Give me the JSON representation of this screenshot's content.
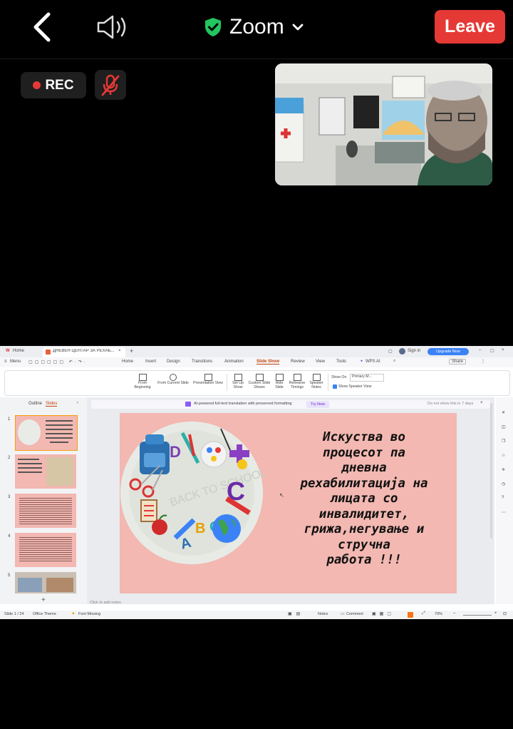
{
  "topbar": {
    "meeting_name": "Zoom",
    "leave_label": "Leave",
    "rec_label": "REC",
    "icons": [
      "back-chevron-icon",
      "speaker-icon",
      "shield-check-icon",
      "chevron-down-icon",
      "mic-muted-icon"
    ],
    "colors": {
      "leave": "#e53935",
      "shield": "#22c55e",
      "background": "#000000"
    }
  },
  "app": {
    "tabs": [
      "Home",
      "ДНЕВЕН ЦЕНТАР ЗА РЕХАБ..."
    ],
    "menu_label": "Menu",
    "ribbon_tabs": [
      "Home",
      "Insert",
      "Design",
      "Transitions",
      "Animation",
      "Slide Show",
      "Review",
      "View",
      "Tools",
      "WPS AI"
    ],
    "active_tab": "Slide Show",
    "sign_in": "Sign in",
    "upgrade": "Upgrade Now",
    "share": "Share",
    "ribbon_buttons": [
      "From Beginning",
      "From Current Slide",
      "Presentation View",
      "Set Up Show",
      "Custom Slide Shows",
      "Hide Slide",
      "Rehearse Timings",
      "Speaker Notes"
    ],
    "show_on_label": "Show On",
    "show_on_value": "Primary M...",
    "speaker_view_label": "Show Speaker View",
    "pane_tabs": [
      "Outline",
      "Slides"
    ],
    "ai_banner": "AI-powered full-text translation with preserved formatting",
    "try_now": "Try Now",
    "dont_show": "Do not show this in 7 days",
    "notes_placeholder": "Click to add notes",
    "status": {
      "slide": "Slide 1 / 24",
      "theme": "Office Theme",
      "font": "Font Missing",
      "notes": "Notes",
      "comment": "Comment",
      "zoom": "79%"
    },
    "thumb_numbers": [
      "1",
      "2",
      "3",
      "4",
      "5"
    ]
  },
  "slide": {
    "lines": [
      "Искуства во",
      "процесот па",
      "дневна",
      "рехабилитација на",
      "лицата со",
      "инвалидитет,",
      "грижа,негување и",
      "стручна",
      "работа !!!"
    ],
    "colors": {
      "background": "#f2b8b1"
    }
  }
}
